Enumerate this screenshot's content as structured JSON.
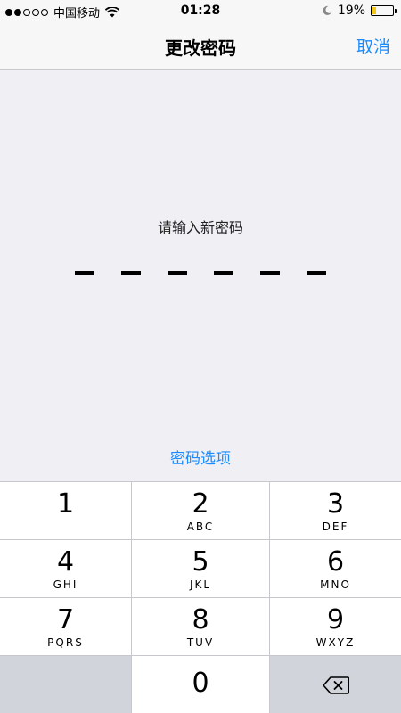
{
  "status_bar": {
    "carrier": "中国移动",
    "time": "01:28",
    "battery_percent": "19%",
    "battery_level": 0.19,
    "signal_bars_filled": 2,
    "signal_bars_total": 5,
    "icons": [
      "wifi-icon",
      "moon-icon",
      "battery-icon"
    ]
  },
  "nav": {
    "title": "更改密码",
    "cancel_label": "取消"
  },
  "main": {
    "prompt": "请输入新密码",
    "passcode_length": 6,
    "options_label": "密码选项"
  },
  "keypad": {
    "keys": [
      {
        "number": "1",
        "letters": ""
      },
      {
        "number": "2",
        "letters": "ABC"
      },
      {
        "number": "3",
        "letters": "DEF"
      },
      {
        "number": "4",
        "letters": "GHI"
      },
      {
        "number": "5",
        "letters": "JKL"
      },
      {
        "number": "6",
        "letters": "MNO"
      },
      {
        "number": "7",
        "letters": "PQRS"
      },
      {
        "number": "8",
        "letters": "TUV"
      },
      {
        "number": "9",
        "letters": "WXYZ"
      },
      {
        "number": "0",
        "letters": ""
      }
    ],
    "backspace_icon": "backspace-icon"
  },
  "colors": {
    "accent": "#1a8cff",
    "background": "#efeff4",
    "key_dark": "#d1d5db",
    "battery_fill": "#f5c518"
  }
}
